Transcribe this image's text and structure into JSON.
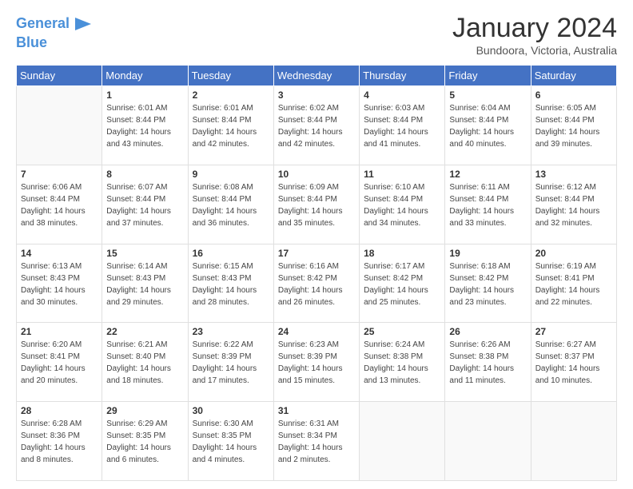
{
  "logo": {
    "line1": "General",
    "line2": "Blue"
  },
  "title": "January 2024",
  "location": "Bundoora, Victoria, Australia",
  "weekdays": [
    "Sunday",
    "Monday",
    "Tuesday",
    "Wednesday",
    "Thursday",
    "Friday",
    "Saturday"
  ],
  "weeks": [
    [
      {
        "day": "",
        "sunrise": "",
        "sunset": "",
        "daylight": ""
      },
      {
        "day": "1",
        "sunrise": "Sunrise: 6:01 AM",
        "sunset": "Sunset: 8:44 PM",
        "daylight": "Daylight: 14 hours and 43 minutes."
      },
      {
        "day": "2",
        "sunrise": "Sunrise: 6:01 AM",
        "sunset": "Sunset: 8:44 PM",
        "daylight": "Daylight: 14 hours and 42 minutes."
      },
      {
        "day": "3",
        "sunrise": "Sunrise: 6:02 AM",
        "sunset": "Sunset: 8:44 PM",
        "daylight": "Daylight: 14 hours and 42 minutes."
      },
      {
        "day": "4",
        "sunrise": "Sunrise: 6:03 AM",
        "sunset": "Sunset: 8:44 PM",
        "daylight": "Daylight: 14 hours and 41 minutes."
      },
      {
        "day": "5",
        "sunrise": "Sunrise: 6:04 AM",
        "sunset": "Sunset: 8:44 PM",
        "daylight": "Daylight: 14 hours and 40 minutes."
      },
      {
        "day": "6",
        "sunrise": "Sunrise: 6:05 AM",
        "sunset": "Sunset: 8:44 PM",
        "daylight": "Daylight: 14 hours and 39 minutes."
      }
    ],
    [
      {
        "day": "7",
        "sunrise": "Sunrise: 6:06 AM",
        "sunset": "Sunset: 8:44 PM",
        "daylight": "Daylight: 14 hours and 38 minutes."
      },
      {
        "day": "8",
        "sunrise": "Sunrise: 6:07 AM",
        "sunset": "Sunset: 8:44 PM",
        "daylight": "Daylight: 14 hours and 37 minutes."
      },
      {
        "day": "9",
        "sunrise": "Sunrise: 6:08 AM",
        "sunset": "Sunset: 8:44 PM",
        "daylight": "Daylight: 14 hours and 36 minutes."
      },
      {
        "day": "10",
        "sunrise": "Sunrise: 6:09 AM",
        "sunset": "Sunset: 8:44 PM",
        "daylight": "Daylight: 14 hours and 35 minutes."
      },
      {
        "day": "11",
        "sunrise": "Sunrise: 6:10 AM",
        "sunset": "Sunset: 8:44 PM",
        "daylight": "Daylight: 14 hours and 34 minutes."
      },
      {
        "day": "12",
        "sunrise": "Sunrise: 6:11 AM",
        "sunset": "Sunset: 8:44 PM",
        "daylight": "Daylight: 14 hours and 33 minutes."
      },
      {
        "day": "13",
        "sunrise": "Sunrise: 6:12 AM",
        "sunset": "Sunset: 8:44 PM",
        "daylight": "Daylight: 14 hours and 32 minutes."
      }
    ],
    [
      {
        "day": "14",
        "sunrise": "Sunrise: 6:13 AM",
        "sunset": "Sunset: 8:43 PM",
        "daylight": "Daylight: 14 hours and 30 minutes."
      },
      {
        "day": "15",
        "sunrise": "Sunrise: 6:14 AM",
        "sunset": "Sunset: 8:43 PM",
        "daylight": "Daylight: 14 hours and 29 minutes."
      },
      {
        "day": "16",
        "sunrise": "Sunrise: 6:15 AM",
        "sunset": "Sunset: 8:43 PM",
        "daylight": "Daylight: 14 hours and 28 minutes."
      },
      {
        "day": "17",
        "sunrise": "Sunrise: 6:16 AM",
        "sunset": "Sunset: 8:42 PM",
        "daylight": "Daylight: 14 hours and 26 minutes."
      },
      {
        "day": "18",
        "sunrise": "Sunrise: 6:17 AM",
        "sunset": "Sunset: 8:42 PM",
        "daylight": "Daylight: 14 hours and 25 minutes."
      },
      {
        "day": "19",
        "sunrise": "Sunrise: 6:18 AM",
        "sunset": "Sunset: 8:42 PM",
        "daylight": "Daylight: 14 hours and 23 minutes."
      },
      {
        "day": "20",
        "sunrise": "Sunrise: 6:19 AM",
        "sunset": "Sunset: 8:41 PM",
        "daylight": "Daylight: 14 hours and 22 minutes."
      }
    ],
    [
      {
        "day": "21",
        "sunrise": "Sunrise: 6:20 AM",
        "sunset": "Sunset: 8:41 PM",
        "daylight": "Daylight: 14 hours and 20 minutes."
      },
      {
        "day": "22",
        "sunrise": "Sunrise: 6:21 AM",
        "sunset": "Sunset: 8:40 PM",
        "daylight": "Daylight: 14 hours and 18 minutes."
      },
      {
        "day": "23",
        "sunrise": "Sunrise: 6:22 AM",
        "sunset": "Sunset: 8:39 PM",
        "daylight": "Daylight: 14 hours and 17 minutes."
      },
      {
        "day": "24",
        "sunrise": "Sunrise: 6:23 AM",
        "sunset": "Sunset: 8:39 PM",
        "daylight": "Daylight: 14 hours and 15 minutes."
      },
      {
        "day": "25",
        "sunrise": "Sunrise: 6:24 AM",
        "sunset": "Sunset: 8:38 PM",
        "daylight": "Daylight: 14 hours and 13 minutes."
      },
      {
        "day": "26",
        "sunrise": "Sunrise: 6:26 AM",
        "sunset": "Sunset: 8:38 PM",
        "daylight": "Daylight: 14 hours and 11 minutes."
      },
      {
        "day": "27",
        "sunrise": "Sunrise: 6:27 AM",
        "sunset": "Sunset: 8:37 PM",
        "daylight": "Daylight: 14 hours and 10 minutes."
      }
    ],
    [
      {
        "day": "28",
        "sunrise": "Sunrise: 6:28 AM",
        "sunset": "Sunset: 8:36 PM",
        "daylight": "Daylight: 14 hours and 8 minutes."
      },
      {
        "day": "29",
        "sunrise": "Sunrise: 6:29 AM",
        "sunset": "Sunset: 8:35 PM",
        "daylight": "Daylight: 14 hours and 6 minutes."
      },
      {
        "day": "30",
        "sunrise": "Sunrise: 6:30 AM",
        "sunset": "Sunset: 8:35 PM",
        "daylight": "Daylight: 14 hours and 4 minutes."
      },
      {
        "day": "31",
        "sunrise": "Sunrise: 6:31 AM",
        "sunset": "Sunset: 8:34 PM",
        "daylight": "Daylight: 14 hours and 2 minutes."
      },
      {
        "day": "",
        "sunrise": "",
        "sunset": "",
        "daylight": ""
      },
      {
        "day": "",
        "sunrise": "",
        "sunset": "",
        "daylight": ""
      },
      {
        "day": "",
        "sunrise": "",
        "sunset": "",
        "daylight": ""
      }
    ]
  ]
}
